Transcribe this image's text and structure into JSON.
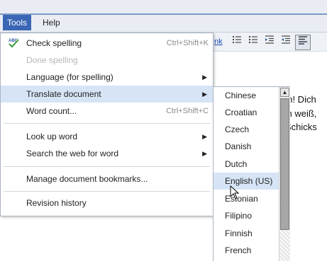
{
  "menubar": {
    "tools_label": "Tools",
    "help_label": "Help"
  },
  "toolbar": {
    "link_label": "nk"
  },
  "document": {
    "lines": [
      "en! Dich",
      "ch weiß,",
      "Schicks"
    ]
  },
  "tools_menu": {
    "items": [
      {
        "label": "Check spelling",
        "shortcut": "Ctrl+Shift+K",
        "icon": "spellcheck-icon",
        "enabled": true
      },
      {
        "label": "Done spelling",
        "shortcut": "",
        "enabled": false
      },
      {
        "label": "Language (for spelling)",
        "submenu": true,
        "enabled": true
      },
      {
        "label": "Translate document",
        "submenu": true,
        "enabled": true,
        "highlighted": true
      },
      {
        "label": "Word count...",
        "shortcut": "Ctrl+Shift+C",
        "enabled": true
      },
      {
        "label": "Look up word",
        "submenu": true,
        "enabled": true
      },
      {
        "label": "Search the web for word",
        "submenu": true,
        "enabled": true
      },
      {
        "label": "Manage document bookmarks...",
        "enabled": true
      },
      {
        "label": "Revision history",
        "enabled": true
      }
    ]
  },
  "translate_submenu": {
    "options": [
      "Chinese",
      "Croatian",
      "Czech",
      "Danish",
      "Dutch",
      "English (US)",
      "Estonian",
      "Filipino",
      "Finnish",
      "French"
    ],
    "hovered": "English (US)"
  },
  "colors": {
    "accent": "#3a66b5",
    "highlight": "#d6e4f6",
    "menubar_bg": "#e9edf3"
  }
}
